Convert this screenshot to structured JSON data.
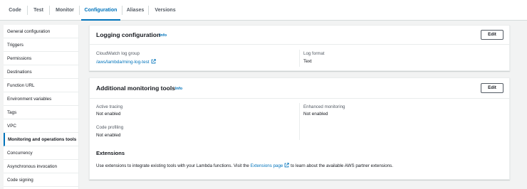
{
  "tabs": [
    {
      "label": "Code"
    },
    {
      "label": "Test"
    },
    {
      "label": "Monitor"
    },
    {
      "label": "Configuration",
      "active": true
    },
    {
      "label": "Aliases"
    },
    {
      "label": "Versions"
    }
  ],
  "sidebar": {
    "items": [
      {
        "label": "General configuration"
      },
      {
        "label": "Triggers"
      },
      {
        "label": "Permissions"
      },
      {
        "label": "Destinations"
      },
      {
        "label": "Function URL"
      },
      {
        "label": "Environment variables"
      },
      {
        "label": "Tags"
      },
      {
        "label": "VPC"
      },
      {
        "label": "Monitoring and operations tools",
        "active": true
      },
      {
        "label": "Concurrency"
      },
      {
        "label": "Asynchronous invocation"
      },
      {
        "label": "Code signing"
      }
    ]
  },
  "logging": {
    "title": "Logging configuration",
    "info": "Info",
    "edit_label": "Edit",
    "log_group_label": "CloudWatch log group",
    "log_group_value": "/aws/lambda/ming-log-test",
    "log_format_label": "Log format",
    "log_format_value": "Text"
  },
  "monitoring": {
    "title": "Additional monitoring tools",
    "info": "Info",
    "edit_label": "Edit",
    "active_tracing_label": "Active tracing",
    "active_tracing_value": "Not enabled",
    "enhanced_monitoring_label": "Enhanced monitoring",
    "enhanced_monitoring_value": "Not enabled",
    "code_profiling_label": "Code profiling",
    "code_profiling_value": "Not enabled",
    "extensions_heading": "Extensions",
    "extensions_text_before": "Use extensions to integrate existing tools with your Lambda functions. Visit the ",
    "extensions_link": "Extensions page",
    "extensions_text_after": " to learn about the available AWS partner extensions."
  },
  "colors": {
    "accent": "#0073bb",
    "background": "#f2f3f3",
    "text": "#16191f",
    "muted": "#545b64"
  },
  "icons": {
    "external_link": "external-link-icon"
  }
}
